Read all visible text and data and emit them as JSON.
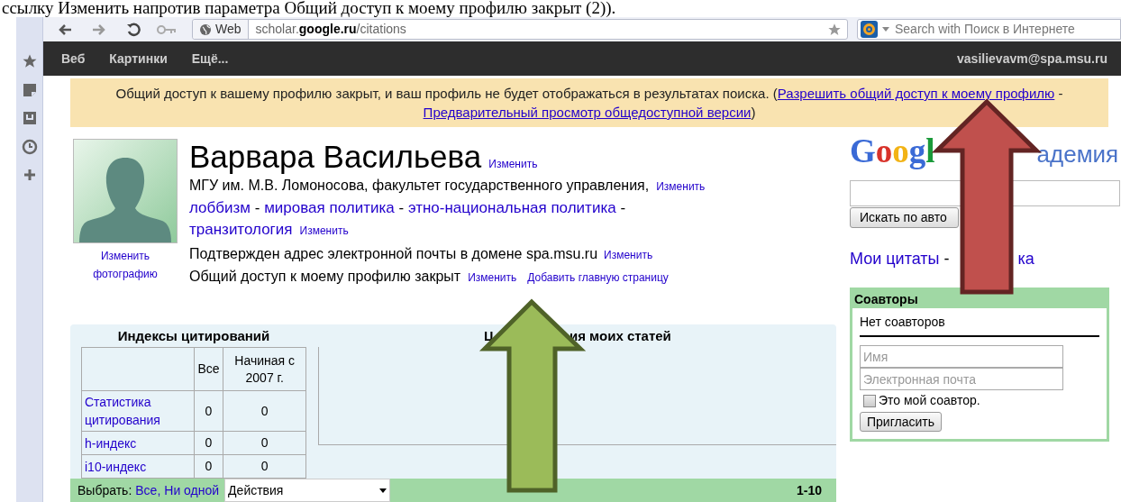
{
  "document_text": "ссылку Изменить напротив параметра Общий доступ к моему профилю закрыт (2)).",
  "browser": {
    "address_chip": "Web",
    "url": "scholar.**google.ru**/citations",
    "search_placeholder": "Search with Поиск в Интернете"
  },
  "nav": {
    "links": [
      "Веб",
      "Картинки",
      "Ещё..."
    ],
    "account": "vasilievavm@spa.msu.ru"
  },
  "banner": [
    {
      "kind": "text",
      "text": "Общий доступ к вашему профилю закрыт, и ваш профиль не будет отображаться в результатах поиска. ("
    },
    {
      "kind": "link",
      "text": "Разрешить общий доступ к моему профилю"
    },
    {
      "kind": "text",
      "text": " - "
    },
    {
      "kind": "link",
      "text": "Предварительный просмотр общедоступной версии"
    },
    {
      "kind": "text",
      "text": ")"
    }
  ],
  "profile": {
    "photo_link": "Изменить фотографию",
    "name": "Варвара Васильева",
    "name_edit": "Изменить",
    "affiliation": "МГУ им. М.В. Ломоносова, факультет государственного управления,",
    "affiliation_edit": "Изменить",
    "interests": [
      "лоббизм",
      "мировая политика",
      "этно-национальная политика",
      "транзитология"
    ],
    "interest_separator": "-",
    "interests_edit": "Изменить",
    "email_note": "Подтвержден адрес электронной почты в домене spa.msu.ru",
    "email_edit": "Изменить",
    "sharing_note": "Общий доступ к моему профилю закрыт",
    "sharing_edit": "Изменить",
    "homepage_link": "Добавить главную страницу"
  },
  "citations": {
    "title": "Индексы цитирований",
    "columns": [
      "Все",
      "Начиная с 2007 г."
    ],
    "rows": [
      {
        "label": "Статистика цитирования",
        "values": [
          "0",
          "0"
        ]
      },
      {
        "label": "h-индекс",
        "values": [
          "0",
          "0"
        ]
      },
      {
        "label": "i10-индекс",
        "values": [
          "0",
          "0"
        ]
      }
    ],
    "chart_title_parts": [
      "Ц",
      "ия моих статей"
    ]
  },
  "list_bar": {
    "label": "Выбрать:",
    "links": [
      "Все,",
      "Ни одной"
    ],
    "actions": "Действия",
    "range": "1-10"
  },
  "sidebar": {
    "logo_parts": [
      "Googl",
      "адемия"
    ],
    "search_button": "Искать по авто",
    "links": [
      "Мои цитаты",
      "-",
      "ка"
    ]
  },
  "coauthors": {
    "title": "Соавторы",
    "empty_note": "Нет соавторов",
    "name_placeholder": "Имя",
    "email_placeholder": "Электронная почта",
    "checkbox": {
      "label": "Это мой соавтор.",
      "checked": false
    },
    "invite_button": "Пригласить"
  }
}
